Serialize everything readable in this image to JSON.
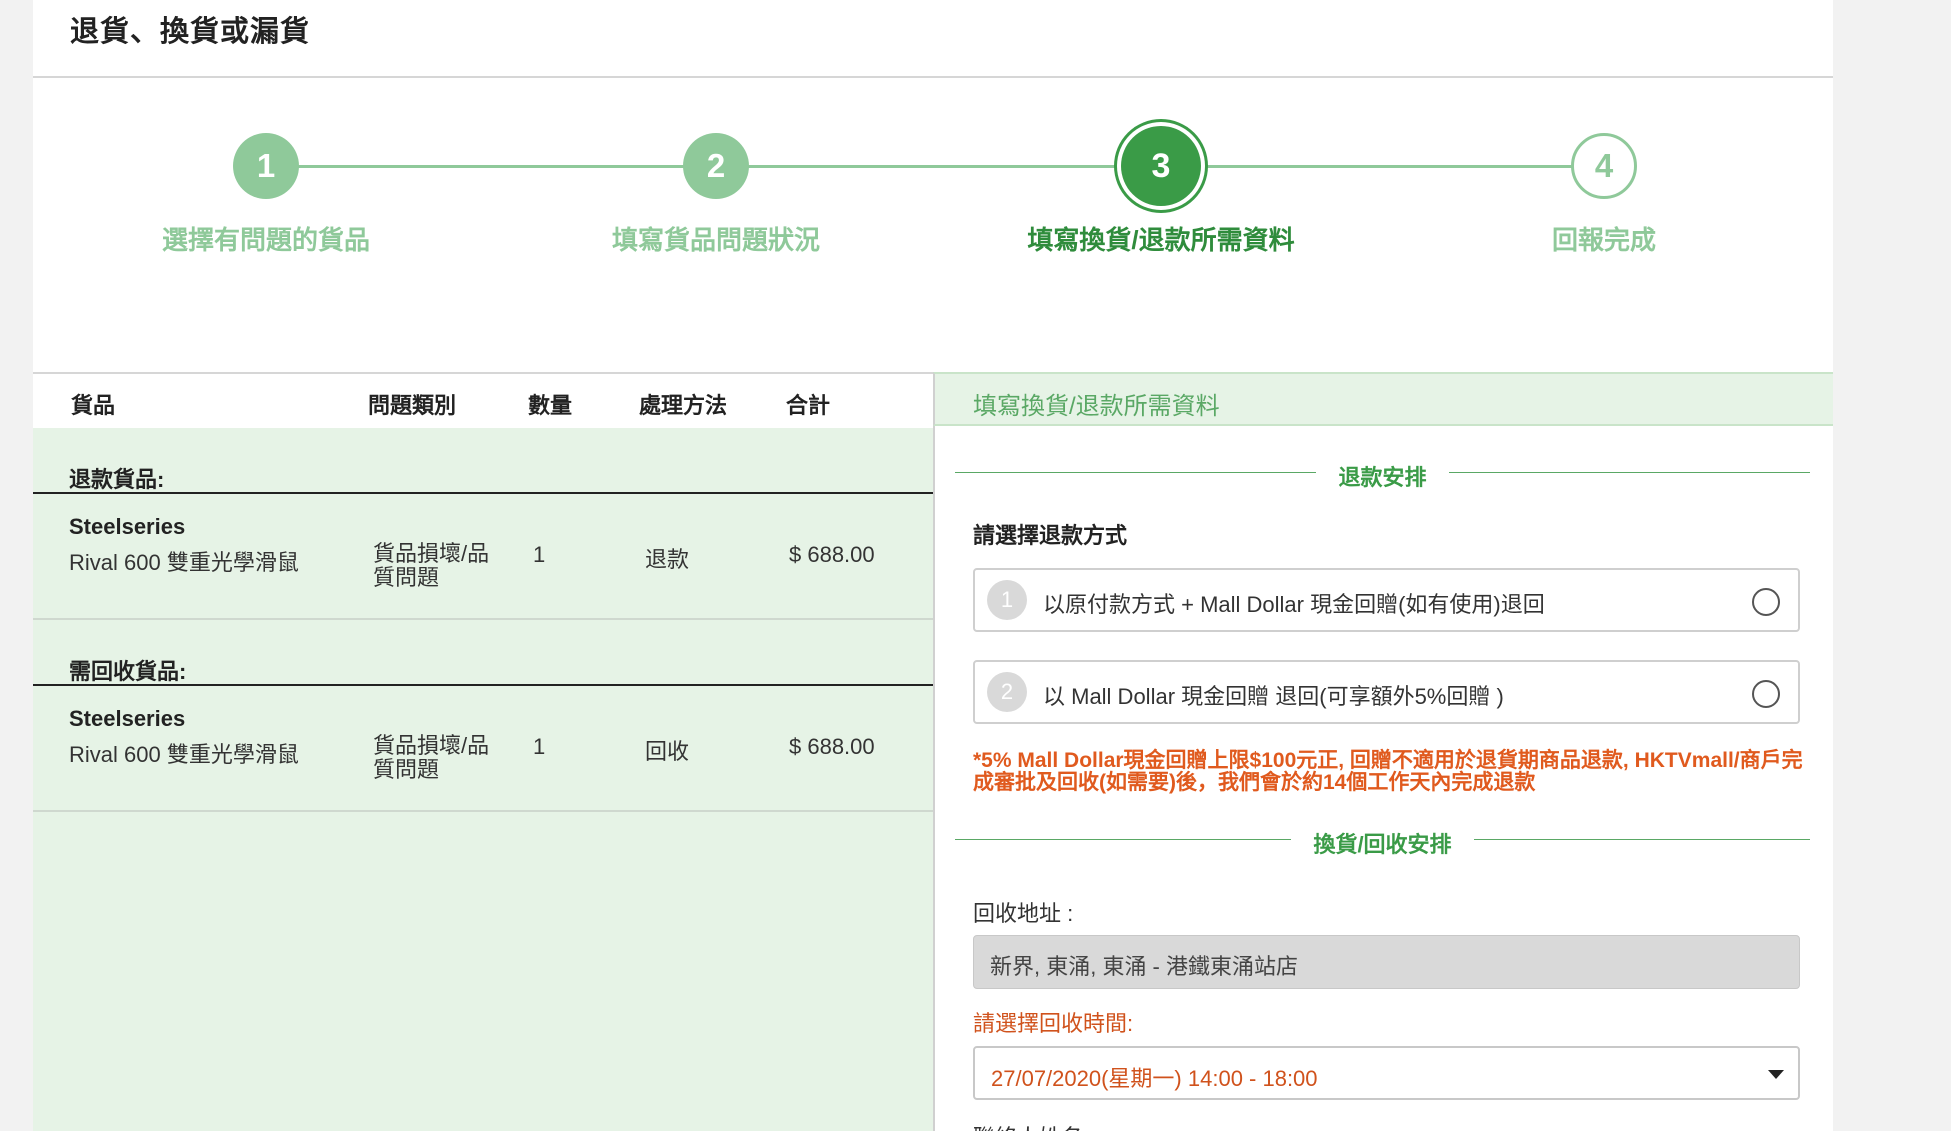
{
  "page": {
    "title": "退貨、換貨或漏貨"
  },
  "stepper": {
    "steps": [
      {
        "number": "1",
        "label": "選擇有問題的貨品"
      },
      {
        "number": "2",
        "label": "填寫貨品問題狀況"
      },
      {
        "number": "3",
        "label": "填寫換貨/退款所需資料"
      },
      {
        "number": "4",
        "label": "回報完成"
      }
    ]
  },
  "table": {
    "headers": [
      "貨品",
      "問題類別",
      "數量",
      "處理方法",
      "合計"
    ],
    "groups": [
      {
        "title": "退款貨品:",
        "row": {
          "brand": "Steelseries",
          "name": "Rival 600 雙重光學滑鼠",
          "issue": "貨品損壞/品質問題",
          "qty": "1",
          "method": "退款",
          "total": "$ 688.00"
        }
      },
      {
        "title": "需回收貨品:",
        "row": {
          "brand": "Steelseries",
          "name": "Rival 600 雙重光學滑鼠",
          "issue": "貨品損壞/品質問題",
          "qty": "1",
          "method": "回收",
          "total": "$ 688.00"
        }
      }
    ]
  },
  "form": {
    "header": "填寫換貨/退款所需資料",
    "refund_section": "退款安排",
    "refund_prompt": "請選擇退款方式",
    "options": [
      {
        "number": "1",
        "text": "以原付款方式 + Mall Dollar 現金回贈(如有使用)退回"
      },
      {
        "number": "2",
        "text": "以 Mall Dollar 現金回贈 退回(可享額外5%回贈 )"
      }
    ],
    "note": "*5% Mall Dollar現金回贈上限$100元正, 回贈不適用於退貨期商品退款, HKTVmall/商戶完成審批及回收(如需要)後，我們會於約14個工作天內完成退款",
    "exchange_section": "換貨/回收安排",
    "address_label": "回收地址 :",
    "address_value": "新界, 東涌, 東涌 - 港鐵東涌站店",
    "time_label": "請選擇回收時間:",
    "time_value": "27/07/2020(星期一) 14:00 - 18:00",
    "contact_label": "聯絡人姓名"
  }
}
